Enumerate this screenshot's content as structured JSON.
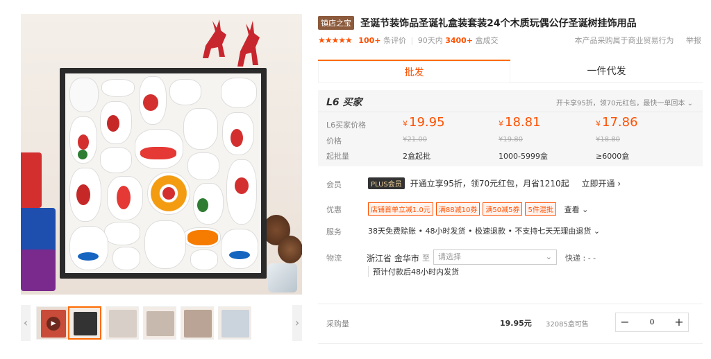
{
  "gallery": {
    "thumb_prev": "‹",
    "thumb_next": "›",
    "play": "▶"
  },
  "product": {
    "badge": "镇店之宝",
    "title": "圣诞节装饰品圣诞礼盒装套装24个木质玩偶公仔圣诞树挂饰用品",
    "stars": "★★★★★",
    "reviews_count": "100+",
    "reviews_label": "条评价",
    "deals_prefix": "90天内",
    "deals_count": "3400+",
    "deals_suffix": "盒成交",
    "trade_note": "本产品采购属于商业贸易行为",
    "report": "举报"
  },
  "tabs": [
    {
      "label": "批发"
    },
    {
      "label": "一件代发"
    }
  ],
  "buyer": {
    "level": "L6 买家",
    "promo": "开卡享95折，领70元红包，最快一单回本 ⌄"
  },
  "pricing": {
    "label_l6": "L6买家价格",
    "label_price": "价格",
    "label_moq": "起批量",
    "currency": "¥",
    "tiers": [
      {
        "price": "19.95",
        "orig": "¥21.00",
        "range": "2盒起批"
      },
      {
        "price": "18.81",
        "orig": "¥19.80",
        "range": "1000-5999盒"
      },
      {
        "price": "17.86",
        "orig": "¥18.80",
        "range": "≥6000盒"
      }
    ]
  },
  "member": {
    "label": "会员",
    "badge": "PLUS会员",
    "text": "开通立享95折，领70元红包，月省1210起",
    "link": "立即开通 ›"
  },
  "discount": {
    "label": "优惠",
    "coupons": [
      "店铺首单立减1.0元",
      "满88减10券",
      "满50减5券",
      "5件混批"
    ],
    "more": "查看 ⌄"
  },
  "service": {
    "label": "服务",
    "text": "38天免费赊账 • 48小时发货 • 极速退款 • 不支持七天无理由退货 ⌄"
  },
  "logistics": {
    "label": "物流",
    "origin": "浙江省 金华市",
    "to": "至",
    "placeholder": "请选择",
    "express": "快递 : - -",
    "note": "预计付款后48小时内发货"
  },
  "purchase": {
    "label": "采购量",
    "price": "19.95元",
    "stock": "32085盒可售",
    "minus": "−",
    "plus": "+",
    "qty": "0"
  }
}
